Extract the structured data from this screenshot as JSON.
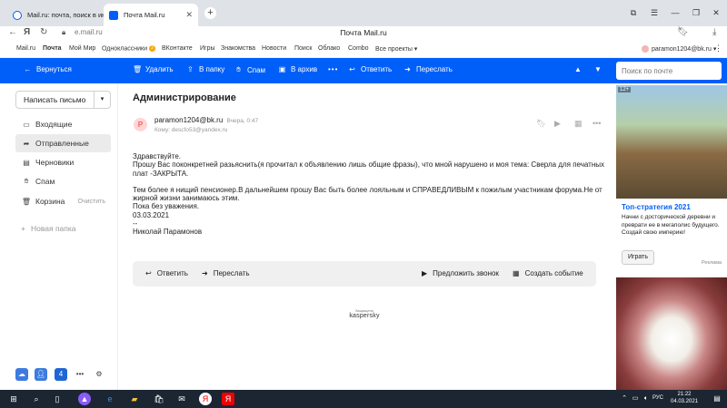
{
  "browser": {
    "tabs": [
      {
        "label": "Mail.ru: почта, поиск в ин",
        "active": false
      },
      {
        "label": "Почта Mail.ru",
        "active": true
      }
    ],
    "url": "e.mail.ru",
    "page_title": "Почта Mail.ru"
  },
  "portal": {
    "items": [
      "Mail.ru",
      "Почта",
      "Мой Мир",
      "Одноклассники",
      "ВКонтакте",
      "Игры",
      "Знакомства",
      "Новости",
      "Поиск",
      "Облако",
      "Combo",
      "Все проекты ▾"
    ],
    "ok_badge": "2",
    "user_email": "paramon1204@bk.ru ▾"
  },
  "toolbar": {
    "back": "Вернуться",
    "delete": "Удалить",
    "to_folder": "В папку",
    "spam": "Спам",
    "archive": "В архив",
    "more": "•••",
    "reply": "Ответить",
    "forward": "Переслать",
    "search_placeholder": "Поиск по почте"
  },
  "sidebar": {
    "compose": "Написать письмо",
    "folders": [
      {
        "label": "Входящие"
      },
      {
        "label": "Отправленные"
      },
      {
        "label": "Черновики"
      },
      {
        "label": "Спам"
      },
      {
        "label": "Корзина",
        "action": "Очистить"
      }
    ],
    "new_folder": "Новая папка"
  },
  "message": {
    "subject": "Администрирование",
    "avatar_letter": "P",
    "from": "paramon1204@bk.ru",
    "date": "Вчера, 0:47",
    "to": "Кому: descfo53@yandex.ru",
    "body": [
      "Здравствуйте.",
      "Прошу Вас поконкретней разьяснить(я прочитал к объявлению лишь общие фразы), что мной нарушено и моя тема: Сверла для печатных плат -ЗАКРЫТА.",
      "",
      "Тем более я нищий пенсионер.В дальнейшем прошу Вас быть более лояльным и СПРАВЕДЛИВЫМ к пожилым участникам форума.Не от жирной жизни занимаюсь этим.",
      "Пока без уважения.",
      "03.03.2021",
      "--",
      "Николай Парамонов"
    ],
    "reply": "Ответить",
    "forward": "Переслать",
    "call": "Предложить звонок",
    "event": "Создать событие",
    "protected_by": "Защищено",
    "kaspersky": "kaspersky"
  },
  "ad": {
    "age": "12+",
    "title": "Топ-стратегия 2021",
    "text": "Начни с досторической деревни и преврати ее в мегаполис будущего. Создай свою империю!",
    "button": "Играть",
    "label": "Реклама"
  },
  "taskbar": {
    "lang": "РУС",
    "time": "21:22",
    "date": "04.03.2021"
  }
}
